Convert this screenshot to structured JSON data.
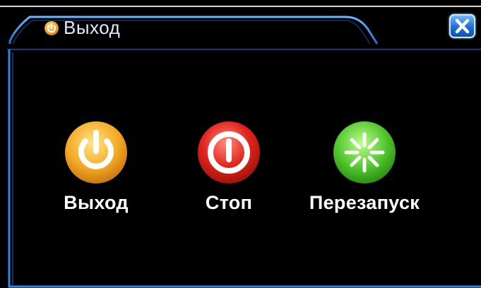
{
  "window": {
    "title": "Выход",
    "title_icon": "power-icon",
    "close_icon": "close-icon"
  },
  "actions": [
    {
      "label": "Выход",
      "icon": "power-icon",
      "color": "#f0a21c"
    },
    {
      "label": "Стоп",
      "icon": "stop-icon",
      "color": "#d8231d"
    },
    {
      "label": "Перезапуск",
      "icon": "restart-icon",
      "color": "#52c22a"
    }
  ],
  "colors": {
    "frame": "#2f86e8",
    "background": "#000000",
    "text": "#ffffff"
  }
}
